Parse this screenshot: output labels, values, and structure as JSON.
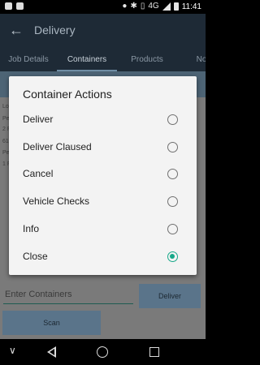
{
  "status_bar": {
    "time": "11:41",
    "network": "4G",
    "icons": [
      "notification-icon",
      "android-icon",
      "location-icon",
      "bluetooth-icon",
      "vibrate-icon",
      "signal-icon",
      "battery-icon"
    ]
  },
  "app_bar": {
    "title": "Delivery",
    "back_icon": "arrow-back-icon"
  },
  "tabs": [
    {
      "label": "Job Details",
      "active": false
    },
    {
      "label": "Containers",
      "active": true
    },
    {
      "label": "Products",
      "active": false
    },
    {
      "label": "No",
      "active": false
    }
  ],
  "background": {
    "lines": [
      "Lo",
      "Pe",
      "2 F",
      "61",
      "Pe",
      "1 F"
    ],
    "containers_placeholder": "Enter Containers",
    "deliver_label": "Deliver",
    "scan_label": "Scan"
  },
  "dialog": {
    "title": "Container Actions",
    "options": [
      {
        "label": "Deliver",
        "checked": false
      },
      {
        "label": "Deliver Claused",
        "checked": false
      },
      {
        "label": "Cancel",
        "checked": false
      },
      {
        "label": "Vehicle Checks",
        "checked": false
      },
      {
        "label": "Info",
        "checked": false
      },
      {
        "label": "Close",
        "checked": true
      }
    ]
  },
  "nav_bar": {
    "icons": [
      "chevron-down-icon",
      "back-triangle-icon",
      "home-circle-icon",
      "recents-square-icon"
    ]
  },
  "colors": {
    "app_bar": "#1e2a36",
    "accent": "#17a889",
    "button": "#5a748a"
  }
}
